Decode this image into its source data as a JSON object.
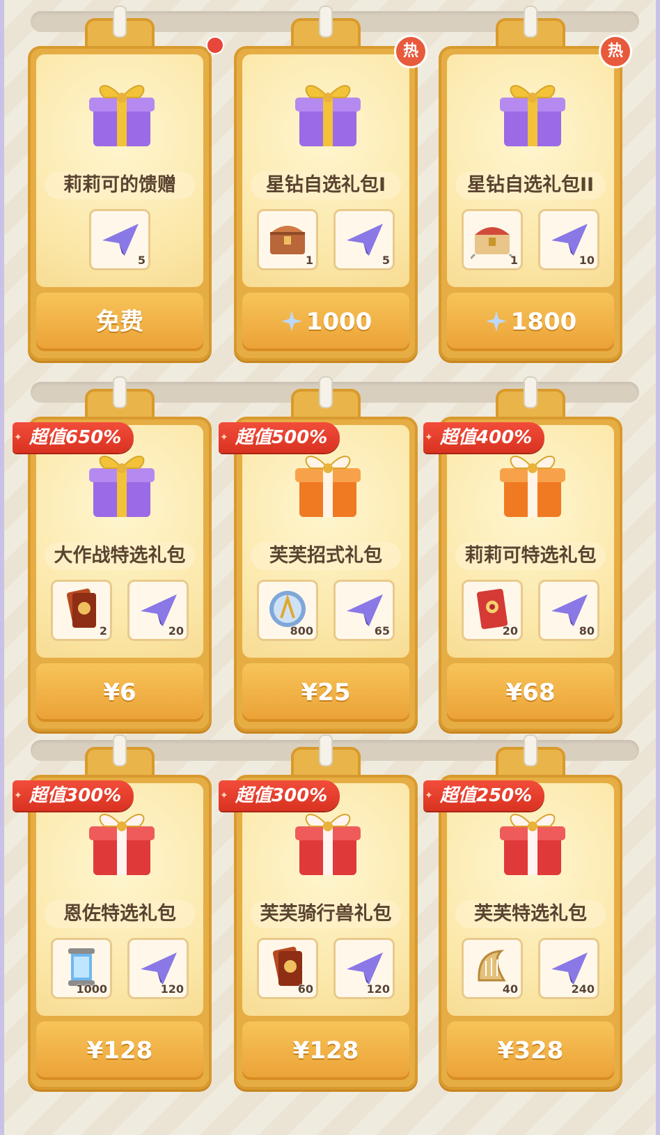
{
  "rows": [
    {
      "cards": [
        {
          "name": "莉莉可的馈赠",
          "gift": "purple",
          "badge": "dot",
          "ribbon": "",
          "price": "免费",
          "currency": "",
          "items": [
            {
              "icon": "paper-plane-icon",
              "qty": "5"
            }
          ]
        },
        {
          "name": "星钻自选礼包I",
          "gift": "purple",
          "badge": "热",
          "ribbon": "",
          "price": "1000",
          "currency": "star-diamond-icon",
          "items": [
            {
              "icon": "treasure-chest-icon",
              "qty": "1"
            },
            {
              "icon": "paper-plane-icon",
              "qty": "5"
            }
          ]
        },
        {
          "name": "星钻自选礼包II",
          "gift": "purple",
          "badge": "热",
          "ribbon": "",
          "price": "1800",
          "currency": "star-diamond-icon",
          "items": [
            {
              "icon": "golden-chest-icon",
              "qty": "1"
            },
            {
              "icon": "paper-plane-icon",
              "qty": "10"
            }
          ]
        }
      ]
    },
    {
      "cards": [
        {
          "name": "大作战特选礼包",
          "gift": "purple",
          "badge": "",
          "ribbon": "超值650%",
          "price": "¥6",
          "currency": "",
          "items": [
            {
              "icon": "card-ticket-icon",
              "qty": "2"
            },
            {
              "icon": "paper-plane-icon",
              "qty": "20"
            }
          ]
        },
        {
          "name": "芙芙招式礼包",
          "gift": "orange",
          "badge": "",
          "ribbon": "超值500%",
          "price": "¥25",
          "currency": "",
          "items": [
            {
              "icon": "crystal-orb-icon",
              "qty": "800"
            },
            {
              "icon": "paper-plane-icon",
              "qty": "65"
            }
          ]
        },
        {
          "name": "莉莉可特选礼包",
          "gift": "orange",
          "badge": "",
          "ribbon": "超值400%",
          "price": "¥68",
          "currency": "",
          "items": [
            {
              "icon": "red-card-icon",
              "qty": "20"
            },
            {
              "icon": "paper-plane-icon",
              "qty": "80"
            }
          ]
        }
      ]
    },
    {
      "cards": [
        {
          "name": "恩佐特选礼包",
          "gift": "red",
          "badge": "",
          "ribbon": "超值300%",
          "price": "¥128",
          "currency": "",
          "items": [
            {
              "icon": "energy-capsule-icon",
              "qty": "1000"
            },
            {
              "icon": "paper-plane-icon",
              "qty": "120"
            }
          ]
        },
        {
          "name": "芙芙骑行兽礼包",
          "gift": "red",
          "badge": "",
          "ribbon": "超值300%",
          "price": "¥128",
          "currency": "",
          "items": [
            {
              "icon": "card-ticket-icon",
              "qty": "60"
            },
            {
              "icon": "paper-plane-icon",
              "qty": "120"
            }
          ]
        },
        {
          "name": "芙芙特选礼包",
          "gift": "red",
          "badge": "",
          "ribbon": "超值250%",
          "price": "¥328",
          "currency": "",
          "items": [
            {
              "icon": "harp-icon",
              "qty": "40"
            },
            {
              "icon": "paper-plane-icon",
              "qty": "240"
            }
          ]
        }
      ]
    }
  ],
  "colors": {
    "purple_box": "#9b6ae6",
    "purple_ribbon": "#f2c238",
    "orange_box": "#f07a22",
    "orange_ribbon": "#fff4e6",
    "red_box": "#e0393a",
    "red_ribbon": "#fff4f0",
    "hot_badge": "#e85a3c",
    "ribbon_red": "#e33b2a"
  }
}
